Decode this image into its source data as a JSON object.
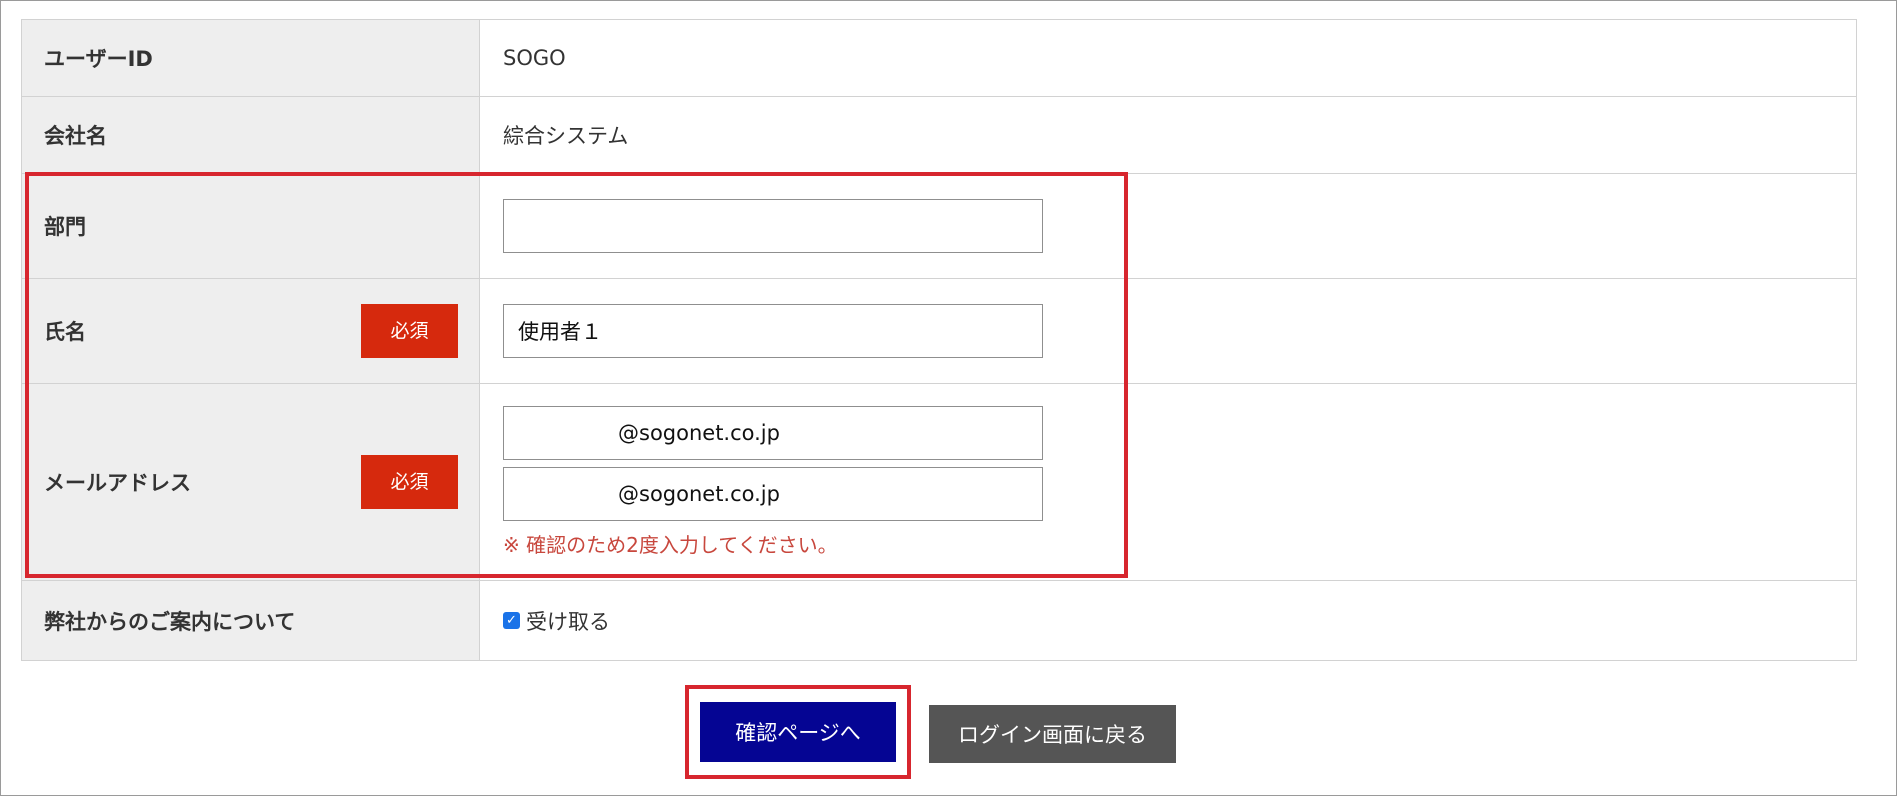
{
  "form": {
    "user_id": {
      "label": "ユーザーID",
      "value": "SOGO"
    },
    "company": {
      "label": "会社名",
      "value": "綜合システム"
    },
    "department": {
      "label": "部門",
      "value": ""
    },
    "name": {
      "label": "氏名",
      "required": "必須",
      "value": "使用者１"
    },
    "email": {
      "label": "メールアドレス",
      "required": "必須",
      "value": "@sogonet.co.jp",
      "confirm_value": "@sogonet.co.jp",
      "note": "※ 確認のため2度入力してください。"
    },
    "newsletter": {
      "label": "弊社からのご案内について",
      "option": "受け取る",
      "checked": true
    }
  },
  "buttons": {
    "confirm": "確認ページへ",
    "back": "ログイン画面に戻る"
  },
  "colors": {
    "required_badge": "#d6290d",
    "primary_button": "#050593",
    "secondary_button": "#555555",
    "highlight": "#d7262e",
    "note_text": "#c8473d",
    "label_bg": "#eeeeee"
  }
}
